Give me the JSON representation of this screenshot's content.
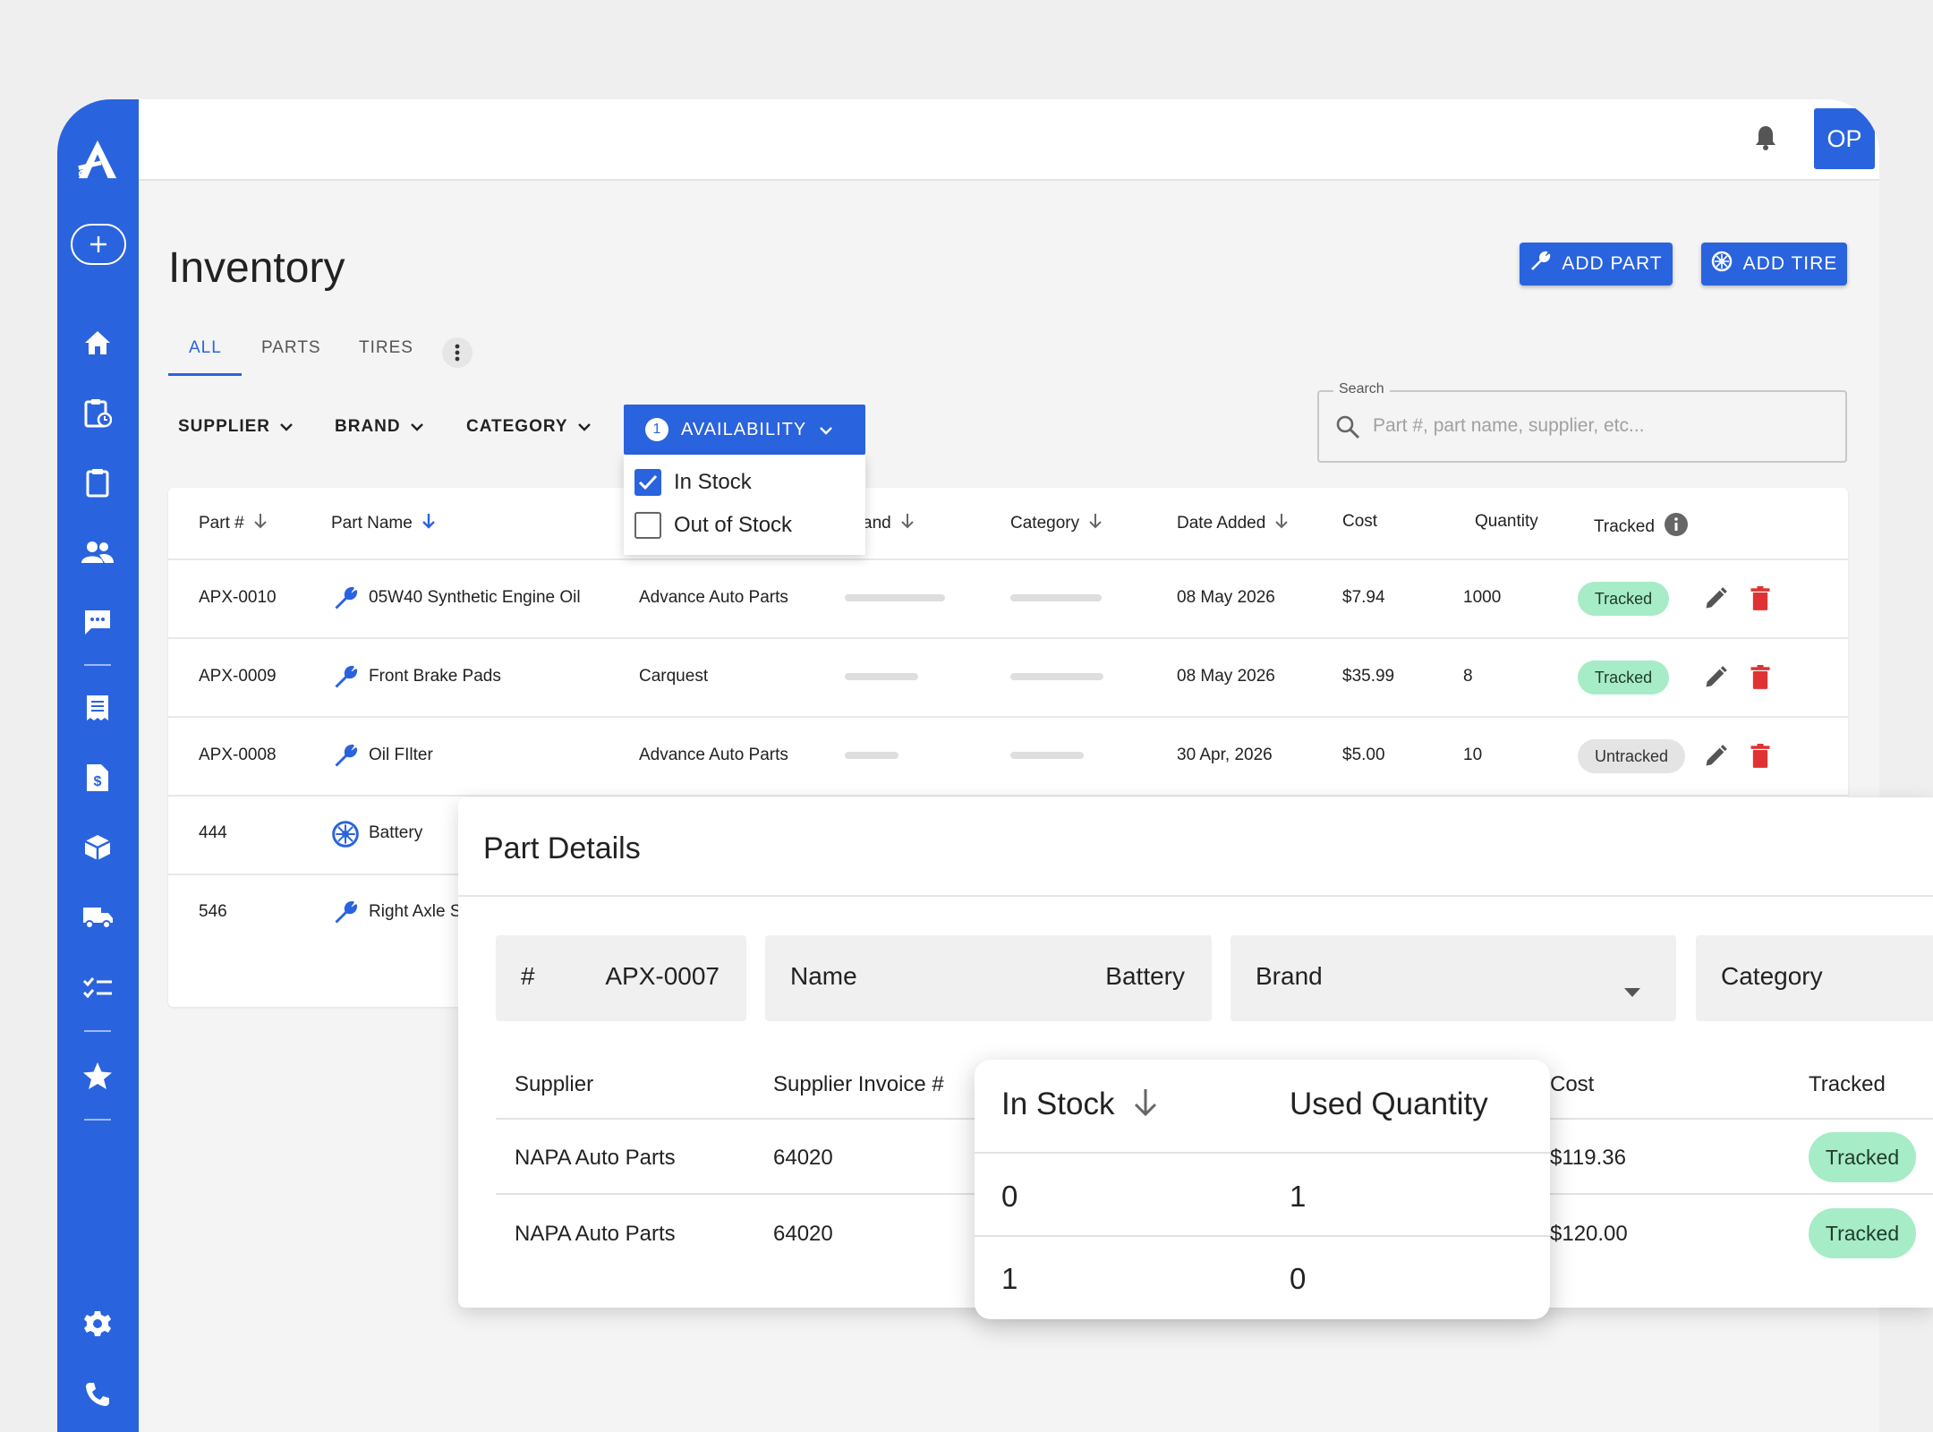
{
  "topbar": {
    "avatar_initials": "OP"
  },
  "page": {
    "title": "Inventory"
  },
  "actions": {
    "add_part": "ADD PART",
    "add_tire": "ADD TIRE"
  },
  "tabs": [
    "ALL",
    "PARTS",
    "TIRES"
  ],
  "filters": {
    "supplier": "SUPPLIER",
    "brand": "BRAND",
    "category": "CATEGORY",
    "availability": "AVAILABILITY",
    "availability_count": "1"
  },
  "availability_options": [
    {
      "label": "In Stock",
      "checked": true
    },
    {
      "label": "Out of Stock",
      "checked": false
    }
  ],
  "search": {
    "label": "Search",
    "placeholder": "Part #, part name, supplier, etc..."
  },
  "table": {
    "headers": {
      "part_no": "Part #",
      "part_name": "Part Name",
      "brand": "and",
      "category": "Category",
      "date_added": "Date Added",
      "cost": "Cost",
      "quantity": "Quantity",
      "tracked": "Tracked"
    },
    "rows": [
      {
        "part_no": "APX-0010",
        "name": "05W40 Synthetic Engine Oil",
        "supplier": "Advance Auto Parts",
        "date": "08 May 2026",
        "cost": "$7.94",
        "qty": "1000",
        "status": "Tracked"
      },
      {
        "part_no": "APX-0009",
        "name": "Front Brake Pads",
        "supplier": "Carquest",
        "date": "08 May 2026",
        "cost": "$35.99",
        "qty": "8",
        "status": "Tracked"
      },
      {
        "part_no": "APX-0008",
        "name": "Oil FIlter",
        "supplier": "Advance Auto Parts",
        "date": "30 Apr, 2026",
        "cost": "$5.00",
        "qty": "10",
        "status": "Untracked"
      },
      {
        "part_no": "444",
        "name": "Battery"
      },
      {
        "part_no": "546",
        "name": "Right Axle S"
      }
    ]
  },
  "part_details": {
    "title": "Part Details",
    "number_label": "#",
    "number_value": "APX-0007",
    "name_label": "Name",
    "name_value": "Battery",
    "brand_label": "Brand",
    "category_label": "Category",
    "headers": {
      "supplier": "Supplier",
      "invoice": "Supplier Invoice #",
      "cost": "Cost",
      "tracked": "Tracked"
    },
    "rows": [
      {
        "supplier": "NAPA Auto Parts",
        "invoice": "64020",
        "cost": "$119.36",
        "status": "Tracked"
      },
      {
        "supplier": "NAPA Auto Parts",
        "invoice": "64020",
        "cost": "$120.00",
        "status": "Tracked"
      }
    ]
  },
  "stock_popup": {
    "headers": {
      "in_stock": "In Stock",
      "used_quantity": "Used Quantity"
    },
    "rows": [
      {
        "in_stock": "0",
        "used": "1"
      },
      {
        "in_stock": "1",
        "used": "0"
      }
    ]
  },
  "colors": {
    "primary": "#2a63de",
    "tracked": "#a6ecc7",
    "delete": "#e03232"
  }
}
